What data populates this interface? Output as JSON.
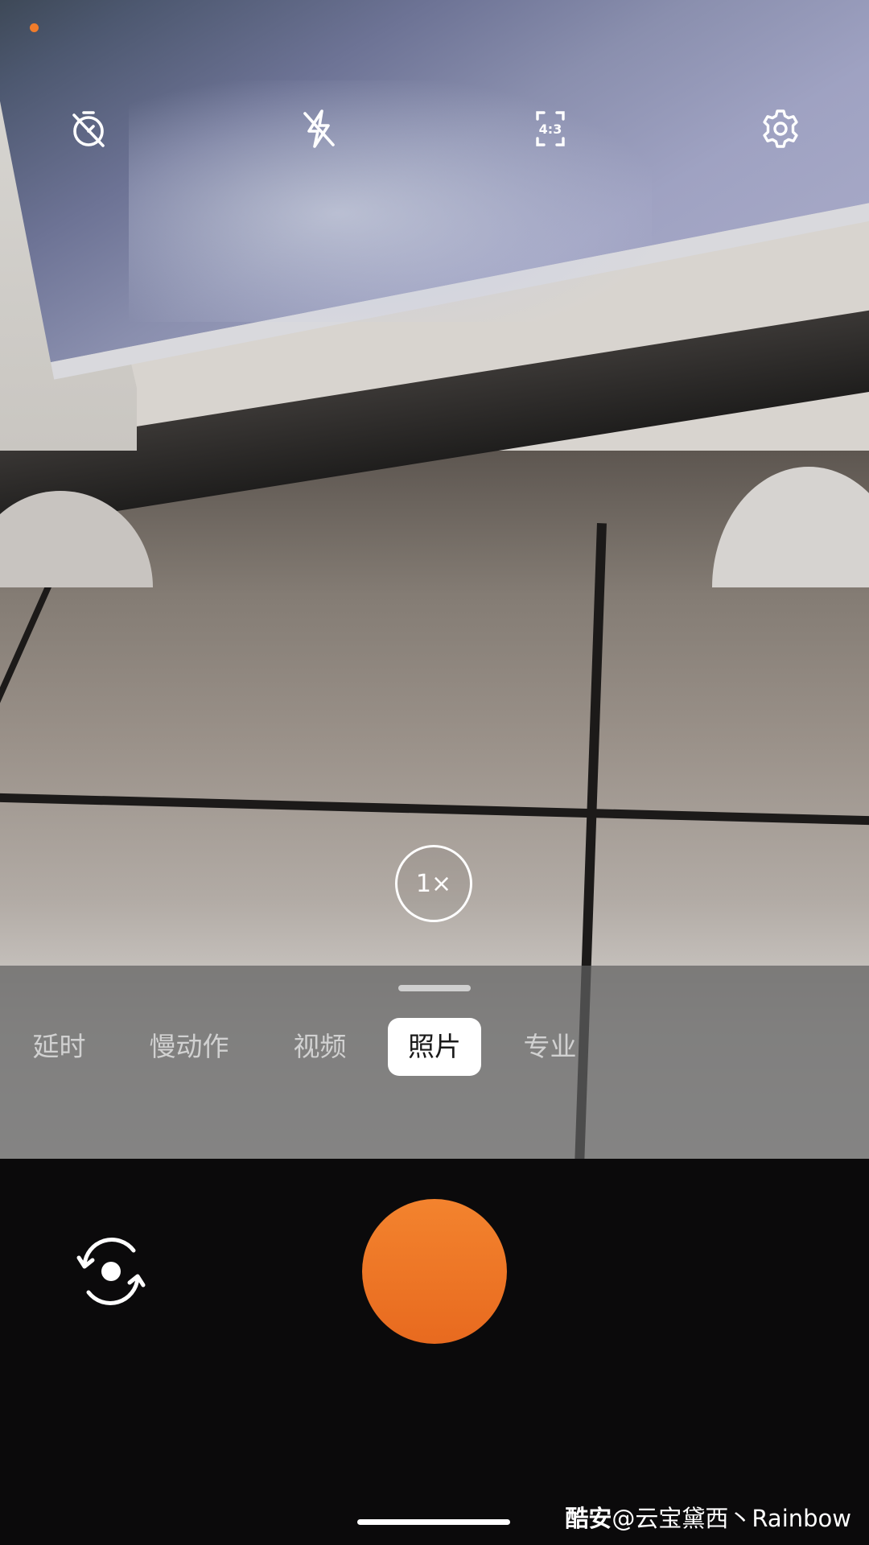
{
  "top_controls": {
    "timer": "timer-off-icon",
    "flash": "flash-off-icon",
    "aspect_ratio": "4:3",
    "settings": "gear-icon"
  },
  "zoom": {
    "label": "1×"
  },
  "modes": {
    "items": [
      "延时",
      "慢动作",
      "视频",
      "照片",
      "专业"
    ],
    "selected": "照片"
  },
  "bottom_controls": {
    "switch_camera": "camera-switch-icon",
    "shutter": "shutter-button",
    "shutter_color": "#ef7627"
  },
  "watermark": {
    "site": "酷安",
    "text": "@云宝黛西丶Rainbow"
  },
  "colors": {
    "accent": "#f07c2b",
    "mode_active_bg": "#ffffff"
  }
}
